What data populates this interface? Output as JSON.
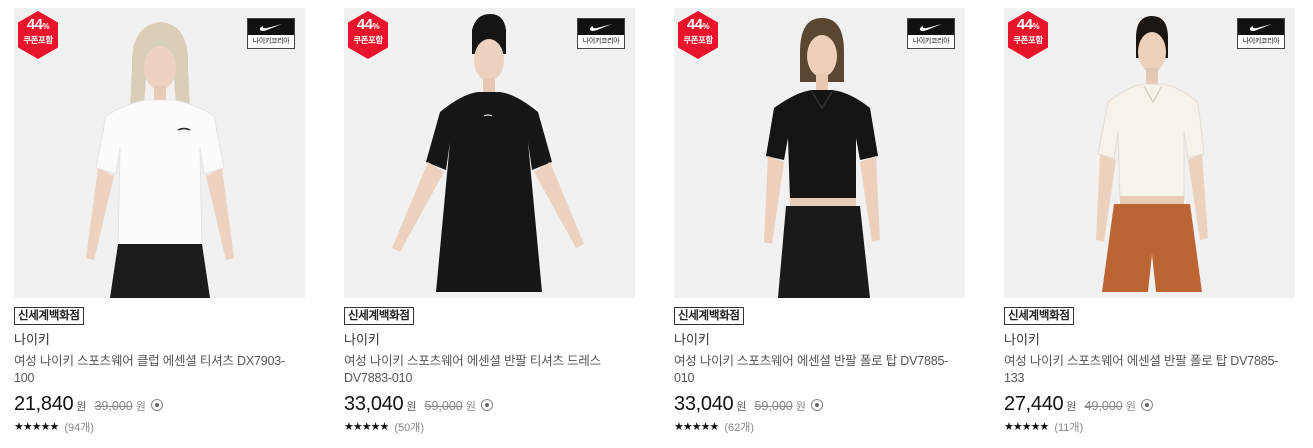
{
  "products": [
    {
      "badge_pct": "44",
      "badge_pct_unit": "%",
      "badge_sub": "쿠폰포함",
      "logo_label": "나이키코리아",
      "store": "신세계백화점",
      "brand": "나이키",
      "title": "여성 나이키 스포츠웨어 클럽 에센셜 티셔츠 DX7903-100",
      "price": "21,840",
      "won": "원",
      "original_price": "39,000",
      "stars": "★★★★★",
      "review_count": "(94개)"
    },
    {
      "badge_pct": "44",
      "badge_pct_unit": "%",
      "badge_sub": "쿠폰포함",
      "logo_label": "나이키코리아",
      "store": "신세계백화점",
      "brand": "나이키",
      "title": "여성 나이키 스포츠웨어 에센셜 반팔 티셔츠 드레스 DV7883-010",
      "price": "33,040",
      "won": "원",
      "original_price": "59,000",
      "stars": "★★★★★",
      "review_count": "(50개)"
    },
    {
      "badge_pct": "44",
      "badge_pct_unit": "%",
      "badge_sub": "쿠폰포함",
      "logo_label": "나이키코리아",
      "store": "신세계백화점",
      "brand": "나이키",
      "title": "여성 나이키 스포츠웨어 에센셜 반팔 폴로 탑 DV7885-010",
      "price": "33,040",
      "won": "원",
      "original_price": "59,000",
      "stars": "★★★★★",
      "review_count": "(62개)"
    },
    {
      "badge_pct": "44",
      "badge_pct_unit": "%",
      "badge_sub": "쿠폰포함",
      "logo_label": "나이키코리아",
      "store": "신세계백화점",
      "brand": "나이키",
      "title": "여성 나이키 스포츠웨어 에센셜 반팔 폴로 탑 DV7885-133",
      "price": "27,440",
      "won": "원",
      "original_price": "49,000",
      "stars": "★★★★★",
      "review_count": "(11개)"
    }
  ],
  "colors": {
    "badge_red": "#e8142b",
    "thumb_bg": "#f1f1f1"
  }
}
